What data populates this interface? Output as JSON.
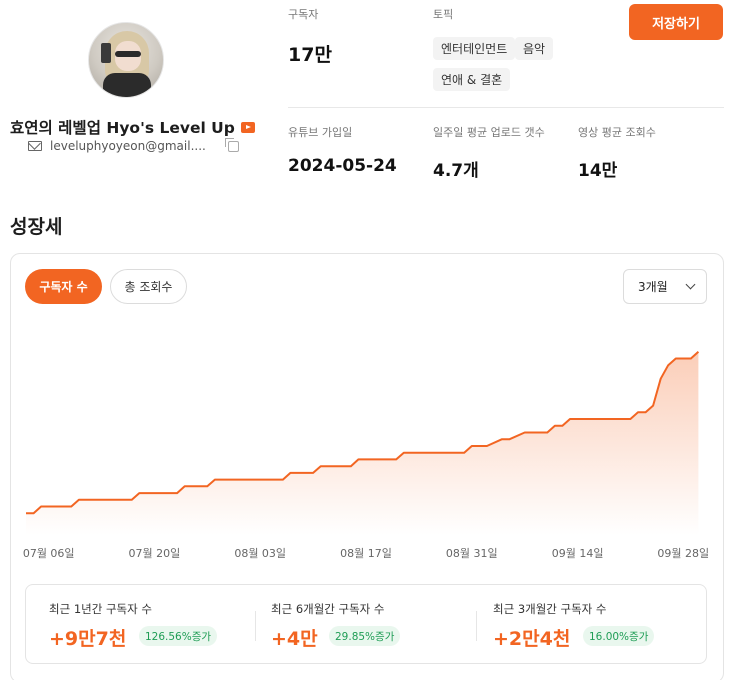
{
  "channel": {
    "name": "효연의 레벨업 Hyo's Level Up",
    "email": "leveluphyoyeon@gmail...."
  },
  "stats": {
    "subscribers_label": "구독자",
    "subscribers_value": "17만",
    "topic_label": "토픽",
    "topics": [
      "엔터테인먼트",
      "음악",
      "연애 & 결혼"
    ],
    "joined_label": "유튜브 가입일",
    "joined_value": "2024-05-24",
    "weekly_uploads_label": "일주일 평균 업로드 갯수",
    "weekly_uploads_value": "4.7개",
    "avg_views_label": "영상 평균 조회수",
    "avg_views_value": "14만"
  },
  "actions": {
    "save_label": "저장하기"
  },
  "growth": {
    "title": "성장세",
    "tabs": [
      {
        "label": "구독자 수",
        "active": true
      },
      {
        "label": "총 조회수",
        "active": false
      }
    ],
    "period": "3개월"
  },
  "chart_data": {
    "type": "area",
    "title": "",
    "xlabel": "",
    "ylabel": "",
    "tick_labels": [
      "07월 06일",
      "07월 20일",
      "08월 03일",
      "08월 17일",
      "08월 31일",
      "09월 14일",
      "09월 28일"
    ],
    "x_range": [
      "2025-07-03",
      "2025-10-01"
    ],
    "y_axis_shown": false,
    "grid": false,
    "line_color": "#f26522",
    "fill_color": "#f26522",
    "series": [
      {
        "values": [
          [
            "2025-07-03",
            130000
          ],
          [
            "2025-07-04",
            130000
          ],
          [
            "2025-07-05",
            131000
          ],
          [
            "2025-07-09",
            131000
          ],
          [
            "2025-07-10",
            132000
          ],
          [
            "2025-07-17",
            132000
          ],
          [
            "2025-07-18",
            133000
          ],
          [
            "2025-07-23",
            133000
          ],
          [
            "2025-07-24",
            134000
          ],
          [
            "2025-07-27",
            134000
          ],
          [
            "2025-07-28",
            135000
          ],
          [
            "2025-08-06",
            135000
          ],
          [
            "2025-08-07",
            136000
          ],
          [
            "2025-08-10",
            136000
          ],
          [
            "2025-08-11",
            137000
          ],
          [
            "2025-08-15",
            137000
          ],
          [
            "2025-08-16",
            138000
          ],
          [
            "2025-08-21",
            138000
          ],
          [
            "2025-08-22",
            139000
          ],
          [
            "2025-08-30",
            139000
          ],
          [
            "2025-08-31",
            140000
          ],
          [
            "2025-09-02",
            140000
          ],
          [
            "2025-09-04",
            141000
          ],
          [
            "2025-09-05",
            141000
          ],
          [
            "2025-09-07",
            142000
          ],
          [
            "2025-09-10",
            142000
          ],
          [
            "2025-09-11",
            143000
          ],
          [
            "2025-09-12",
            143000
          ],
          [
            "2025-09-13",
            144000
          ],
          [
            "2025-09-21",
            144000
          ],
          [
            "2025-09-22",
            145000
          ],
          [
            "2025-09-23",
            145000
          ],
          [
            "2025-09-24",
            146000
          ],
          [
            "2025-09-25",
            150000
          ],
          [
            "2025-09-26",
            152000
          ],
          [
            "2025-09-27",
            153000
          ],
          [
            "2025-09-29",
            153000
          ],
          [
            "2025-09-30",
            154000
          ]
        ]
      }
    ],
    "ylim": [
      129000,
      155000
    ]
  },
  "summary": [
    {
      "label": "최근 1년간 구독자 수",
      "value": "+9만7천",
      "change": "126.56%증가"
    },
    {
      "label": "최근 6개월간 구독자 수",
      "value": "+4만",
      "change": "29.85%증가"
    },
    {
      "label": "최근 3개월간 구독자 수",
      "value": "+2만4천",
      "change": "16.00%증가"
    }
  ]
}
